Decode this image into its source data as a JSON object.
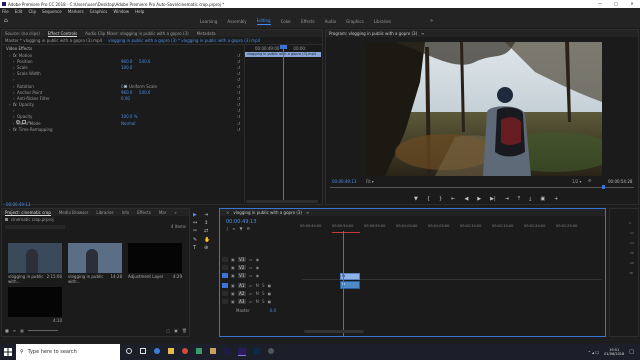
{
  "window": {
    "title": "Adobe Premiere Pro CC 2018 - C:\\Users\\user\\Desktop\\Adobe Premiere Pro Auto-Save\\cinematic crop.prproj *",
    "minimize": "—",
    "maximize": "□",
    "close": "✕"
  },
  "menu": [
    "File",
    "Edit",
    "Clip",
    "Sequence",
    "Markers",
    "Graphics",
    "Window",
    "Help"
  ],
  "workspaces": {
    "items": [
      "Learning",
      "Assembly",
      "Editing",
      "Color",
      "Effects",
      "Audio",
      "Graphics",
      "Libraries"
    ],
    "active": "Editing",
    "more": "»"
  },
  "source_panel": {
    "tabs": [
      "Source: (no clips)",
      "Effect Controls",
      "Audio Clip Mixer: vlogging in public with a gopro (3)",
      "Metadata"
    ],
    "active": "Effect Controls",
    "master": "Master * vlogging in public with a gopro (3).mp4",
    "clip": "vlogging in public with a gopro (3) * vlogging in public with a gopro (3).mp4",
    "ruler_time": "00:00:49:00",
    "ruler_time2": "00:00:",
    "clip_bar_label": "vlogging in public with a gopro (3).mp4",
    "video_effects": "Video Effects",
    "rows": [
      {
        "label": "Motion",
        "v1": "",
        "v2": "",
        "indent": 1
      },
      {
        "label": "Position",
        "v1": "960.0",
        "v2": "540.0",
        "indent": 2
      },
      {
        "label": "Scale",
        "v1": "100.0",
        "v2": "",
        "indent": 2
      },
      {
        "label": "Scale Width",
        "v1": "",
        "v2": "",
        "indent": 2
      },
      {
        "label": "",
        "v1": "",
        "v2": "",
        "indent": 2
      },
      {
        "label": "Rotation",
        "v1": "0.0",
        "v2": "",
        "indent": 2
      },
      {
        "label": "Anchor Point",
        "v1": "960.0",
        "v2": "540.0",
        "indent": 2
      },
      {
        "label": "Anti-flicker Filter",
        "v1": "0.00",
        "v2": "",
        "indent": 2
      },
      {
        "label": "Opacity",
        "v1": "",
        "v2": "",
        "indent": 1
      },
      {
        "label": "",
        "v1": "",
        "v2": "",
        "indent": 2
      },
      {
        "label": "Opacity",
        "v1": "100.0 %",
        "v2": "",
        "indent": 2
      },
      {
        "label": "Blend Mode",
        "v1": "Normal",
        "v2": "",
        "indent": 2
      },
      {
        "label": "Time Remapping",
        "v1": "",
        "v2": "",
        "indent": 1
      }
    ],
    "uniform_scale": "Uniform Scale",
    "timecode": "00:00:49:13"
  },
  "program": {
    "title": "Program: vlogging in public with a gopro (3)",
    "timecode": "00:00:49:13",
    "fit": "Fit",
    "ratio": "1/2",
    "duration": "00:00:54:28"
  },
  "project": {
    "tabs": [
      "Project: cinematic crop",
      "Media Browser",
      "Libraries",
      "Info",
      "Effects",
      "Mar"
    ],
    "more": "»",
    "file": "cinematic crop.prproj",
    "items_count": "4 Items",
    "items": [
      {
        "name": "vlogging in public with...",
        "dur": "2:15:06"
      },
      {
        "name": "vlogging in public with...",
        "dur": "14:28"
      },
      {
        "name": "Adjustment Layer",
        "dur": "4:29"
      },
      {
        "name": "",
        "dur": "4:10"
      }
    ]
  },
  "timeline": {
    "tab": "vlogging in public with a gopro (3)",
    "timecode": "00:00:49:13",
    "ruler": [
      "00:00:45:00",
      "00:00:50:00",
      "00:00:55:00",
      "00:01:00:00",
      "00:01:05:00",
      "00:01:10:00",
      "00:01:15:00",
      "00:01:20:00",
      "00:01:25:00"
    ],
    "tracks_v": [
      "V3",
      "V2",
      "V1"
    ],
    "tracks_a": [
      "A1",
      "A2",
      "A3"
    ],
    "master": "Master",
    "master_val": "0.0",
    "v1_clip_label": "fx",
    "a1_clip_label": "fx"
  },
  "taskbar": {
    "search": "Type here to search",
    "time": "19:51",
    "date": "01/06/2018"
  }
}
